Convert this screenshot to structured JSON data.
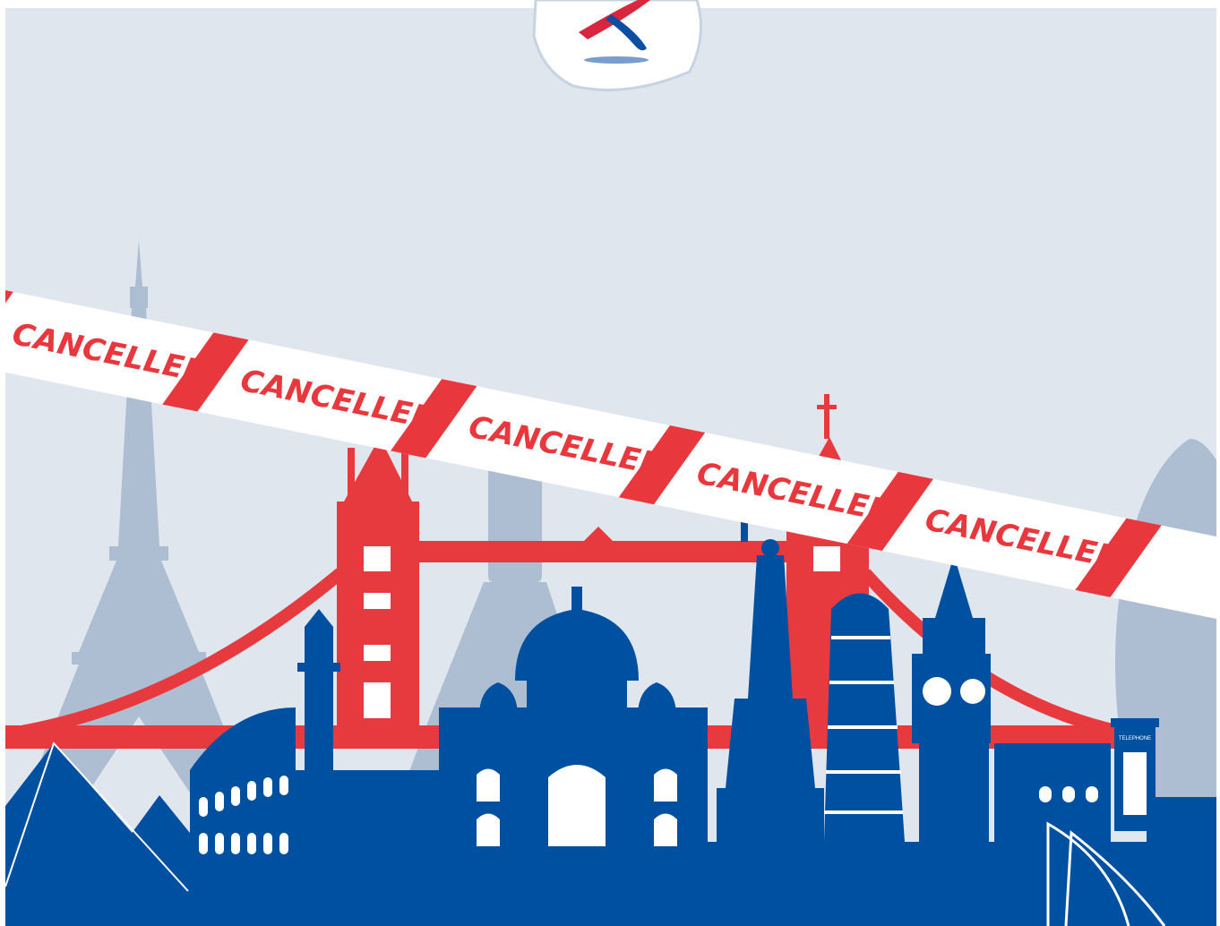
{
  "colors": {
    "background": "#dfe6ee",
    "tape_red": "#e8383d",
    "tape_white": "#ffffff",
    "primary_blue": "#0050a1",
    "faded_blue": "#adbdd2",
    "bridge_red": "#e63a3e"
  },
  "logo": {
    "icon": "airline-x-logo-icon"
  },
  "tape": {
    "labels": [
      "CANCELLED",
      "CANCELLED",
      "CANCELLED",
      "CANCELLED",
      "CANCELLED"
    ]
  },
  "landmarks": [
    "eiffel-tower",
    "tower-bridge",
    "colosseum",
    "taj-mahal",
    "statue-of-liberty",
    "leaning-tower-of-pisa",
    "big-ben",
    "great-wall",
    "telephone-box",
    "gherkin-tower",
    "pyramids"
  ],
  "phone_box": {
    "label": "TELEPHONE"
  }
}
